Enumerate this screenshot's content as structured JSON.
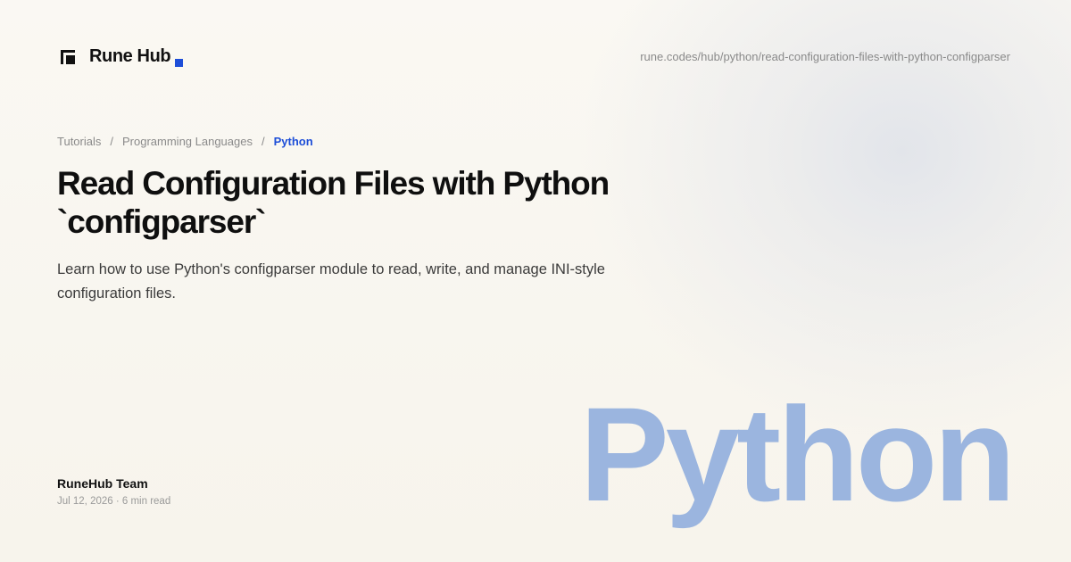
{
  "brand": {
    "name": "Rune Hub",
    "accent_color": "#1d4ed8"
  },
  "url": "rune.codes/hub/python/read-configuration-files-with-python-configparser",
  "breadcrumb": [
    {
      "label": "Tutorials"
    },
    {
      "label": "Programming Languages"
    },
    {
      "label": "Python"
    }
  ],
  "breadcrumb_separator": "/",
  "article": {
    "title_line1": "Read Configuration Files with Python",
    "title_line2": "`configparser`",
    "description": "Learn how to use Python's configparser module to read, write, and manage INI-style configuration files.",
    "author": "RuneHub Team",
    "meta": "Jul 12, 2026 · 6 min read"
  },
  "language_word": "Python",
  "language_word_color": "#9bb5df"
}
